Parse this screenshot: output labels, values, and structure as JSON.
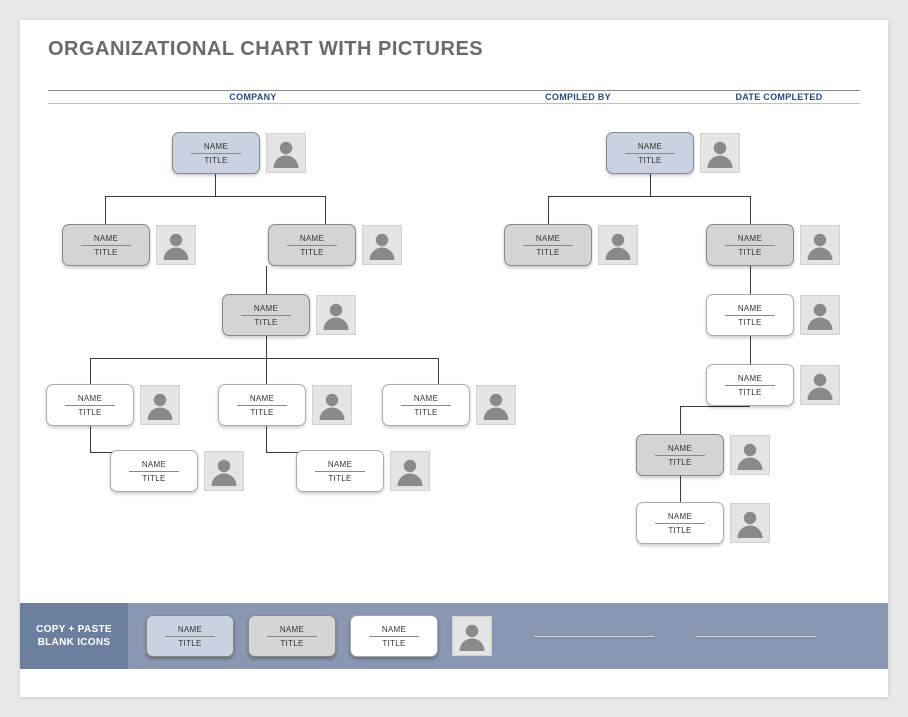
{
  "title": "ORGANIZATIONAL CHART WITH PICTURES",
  "header": {
    "company": "COMPANY",
    "compiledBy": "COMPILED BY",
    "dateCompleted": "DATE COMPLETED"
  },
  "labels": {
    "name": "NAME",
    "title": "TITLE"
  },
  "footer": {
    "label": "COPY + PASTE BLANK ICONS"
  },
  "nodes": {
    "left": {
      "root": {
        "name": "NAME",
        "title": "TITLE"
      },
      "l2a": {
        "name": "NAME",
        "title": "TITLE"
      },
      "l2b": {
        "name": "NAME",
        "title": "TITLE"
      },
      "l3": {
        "name": "NAME",
        "title": "TITLE"
      },
      "l4a": {
        "name": "NAME",
        "title": "TITLE"
      },
      "l4b": {
        "name": "NAME",
        "title": "TITLE"
      },
      "l4c": {
        "name": "NAME",
        "title": "TITLE"
      },
      "l5a": {
        "name": "NAME",
        "title": "TITLE"
      },
      "l5b": {
        "name": "NAME",
        "title": "TITLE"
      }
    },
    "right": {
      "root": {
        "name": "NAME",
        "title": "TITLE"
      },
      "r2a": {
        "name": "NAME",
        "title": "TITLE"
      },
      "r2b": {
        "name": "NAME",
        "title": "TITLE"
      },
      "r3": {
        "name": "NAME",
        "title": "TITLE"
      },
      "r4": {
        "name": "NAME",
        "title": "TITLE"
      },
      "r5": {
        "name": "NAME",
        "title": "TITLE"
      },
      "r6": {
        "name": "NAME",
        "title": "TITLE"
      }
    }
  },
  "footerCards": {
    "a": {
      "name": "NAME",
      "title": "TITLE"
    },
    "b": {
      "name": "NAME",
      "title": "TITLE"
    },
    "c": {
      "name": "NAME",
      "title": "TITLE"
    }
  }
}
